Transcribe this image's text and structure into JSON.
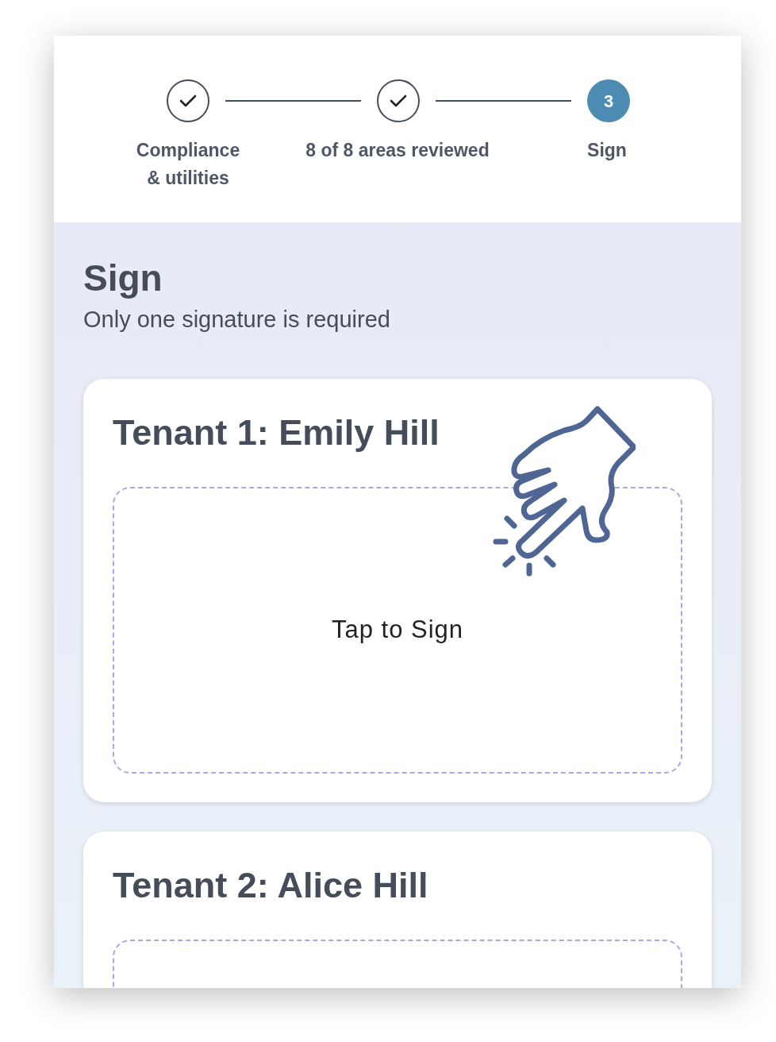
{
  "steps": [
    {
      "label": "Compliance\n& utilities",
      "completed": true
    },
    {
      "label": "8 of 8 areas reviewed",
      "completed": true
    },
    {
      "label": "Sign",
      "number": "3",
      "completed": false
    }
  ],
  "heading": "Sign",
  "subtitle": "Only one signature is required",
  "tenants": [
    {
      "name": "Tenant 1: Emily Hill",
      "prompt": "Tap to Sign"
    },
    {
      "name": "Tenant 2: Alice Hill"
    }
  ]
}
